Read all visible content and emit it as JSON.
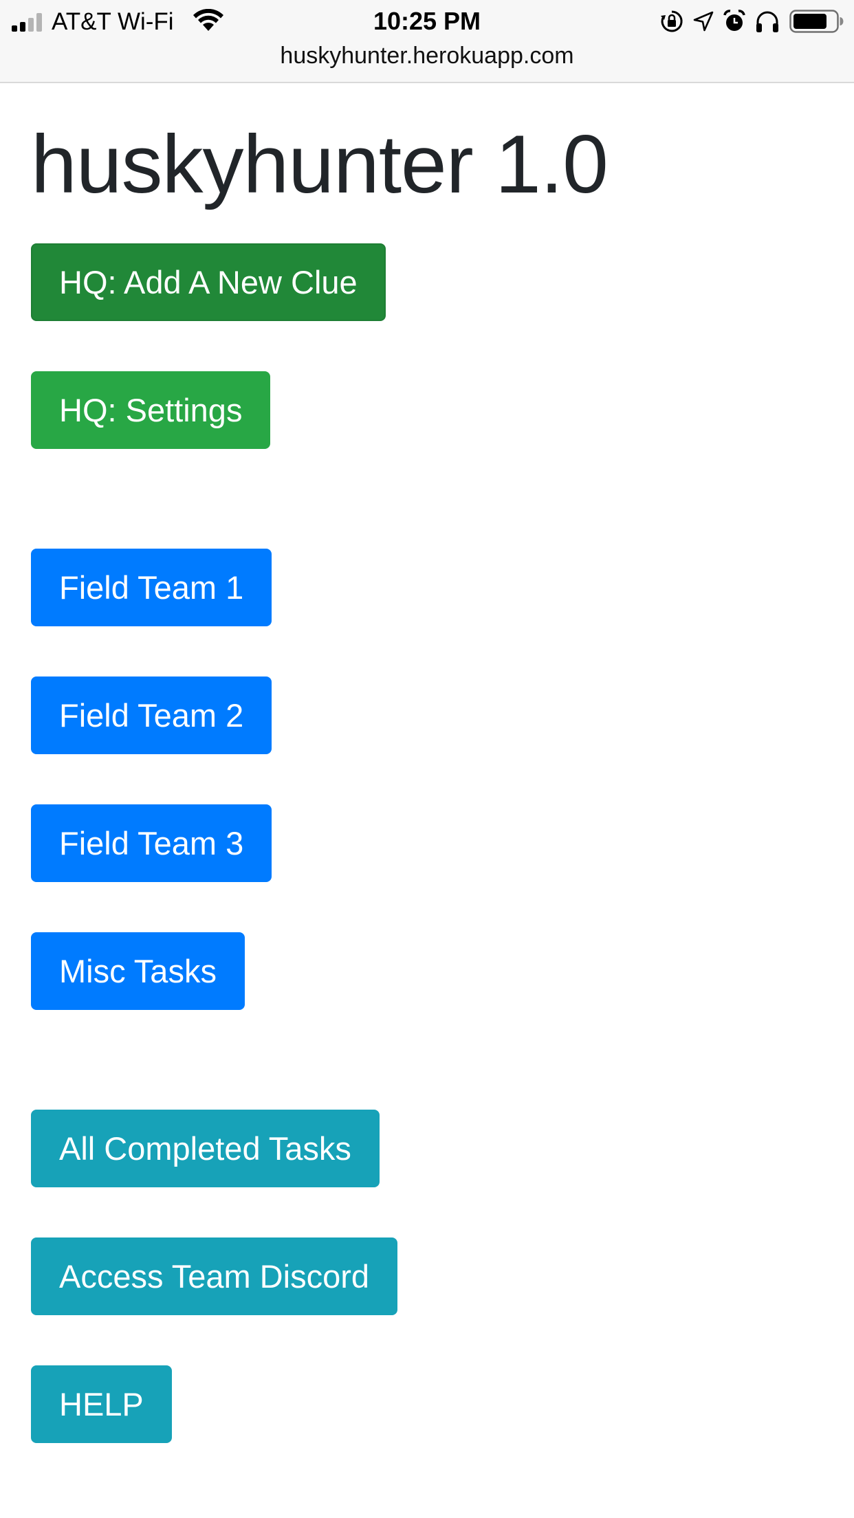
{
  "status_bar": {
    "carrier": "AT&T Wi-Fi",
    "time": "10:25 PM",
    "icons": [
      "signal-bars-icon",
      "wifi-icon",
      "orientation-lock-icon",
      "location-arrow-icon",
      "alarm-clock-icon",
      "headphones-icon",
      "battery-icon"
    ]
  },
  "browser": {
    "url": "huskyhunter.herokuapp.com"
  },
  "page": {
    "title": "huskyhunter 1.0"
  },
  "buttons": {
    "hq_add_clue": "HQ: Add A New Clue",
    "hq_settings": "HQ: Settings",
    "field_team_1": "Field Team 1",
    "field_team_2": "Field Team 2",
    "field_team_3": "Field Team 3",
    "misc_tasks": "Misc Tasks",
    "all_completed_tasks": "All Completed Tasks",
    "access_team_discord": "Access Team Discord",
    "help": "HELP"
  },
  "colors": {
    "success_active": "#218838",
    "success": "#28a745",
    "primary": "#007bff",
    "info": "#17a2b8",
    "heading_text": "#212529"
  }
}
